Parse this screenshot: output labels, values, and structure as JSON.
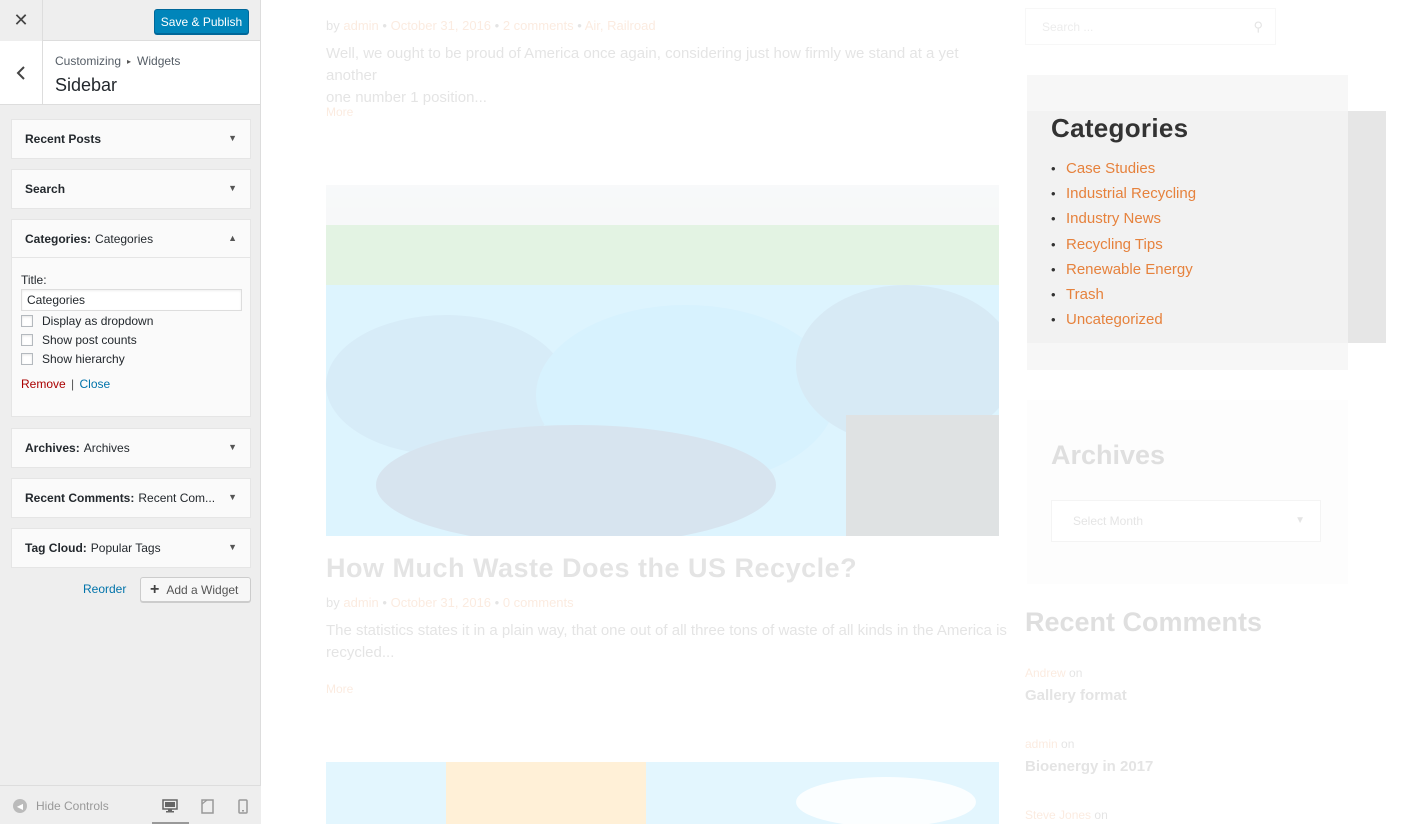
{
  "customizer": {
    "close_icon": "close-icon",
    "save_label": "Save & Publish",
    "breadcrumb": [
      "Customizing",
      "Widgets"
    ],
    "breadcrumb_sep": "▸",
    "section_title": "Sidebar",
    "widgets": [
      {
        "title": "Recent Posts",
        "sub": ""
      },
      {
        "title": "Search",
        "sub": ""
      },
      {
        "title": "Categories:",
        "sub": "Categories"
      },
      {
        "title": "Archives:",
        "sub": "Archives"
      },
      {
        "title": "Recent Comments:",
        "sub": "Recent Com..."
      },
      {
        "title": "Tag Cloud:",
        "sub": "Popular Tags"
      }
    ],
    "categories_form": {
      "title_label": "Title:",
      "title_value": "Categories",
      "options": [
        {
          "label": "Display as dropdown",
          "checked": false
        },
        {
          "label": "Show post counts",
          "checked": false
        },
        {
          "label": "Show hierarchy",
          "checked": false
        }
      ],
      "remove_label": "Remove",
      "close_label": "Close"
    },
    "reorder_label": "Reorder",
    "add_widget_label": "Add a Widget",
    "hide_controls_label": "Hide Controls"
  },
  "preview": {
    "post1": {
      "meta_by": "by",
      "author": "admin",
      "date": "October 31, 2016",
      "comments": "2 comments",
      "tags": "Air, Railroad",
      "excerpt_line1": "Well, we ought to be proud of America once again, considering just how firmly we stand at a yet another",
      "excerpt_line2": "one number 1 position...",
      "more": "More"
    },
    "post2": {
      "title": "How Much Waste Does the US Recycle?",
      "meta_by": "by",
      "author": "admin",
      "date": "October 31, 2016",
      "comments": "0 comments",
      "excerpt_line1": "The statistics states it in a plain way, that one out of all three tons of waste of all kinds in the America is",
      "excerpt_line2": "recycled...",
      "more": "More"
    },
    "search_placeholder": "Search ...",
    "categories": {
      "heading": "Categories",
      "items": [
        "Case Studies",
        "Industrial Recycling",
        "Industry News",
        "Recycling Tips",
        "Renewable Energy",
        "Trash",
        "Uncategorized"
      ]
    },
    "archives": {
      "heading": "Archives",
      "select_label": "Select Month"
    },
    "recent_comments": {
      "heading": "Recent Comments",
      "items": [
        {
          "author": "Andrew",
          "on": "on",
          "post": "Gallery format"
        },
        {
          "author": "admin",
          "on": "on",
          "post": "Bioenergy in 2017"
        },
        {
          "author": "Steve Jones",
          "on": "on",
          "post": ""
        }
      ]
    },
    "colors": {
      "accent": "#e6823d",
      "wp_blue": "#0085ba"
    }
  }
}
